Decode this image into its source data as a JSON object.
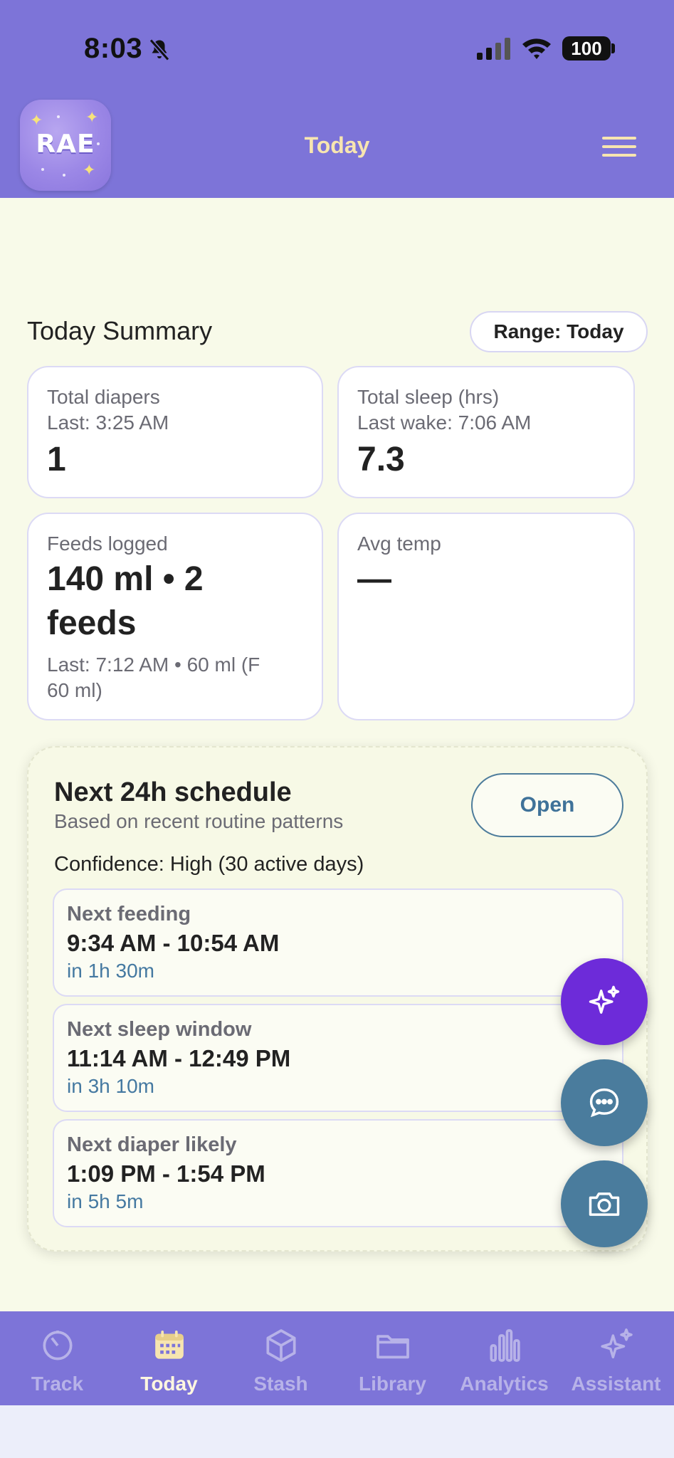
{
  "status_bar": {
    "time": "8:03",
    "battery": "100"
  },
  "header": {
    "logo_text": "RAE",
    "title": "Today"
  },
  "summary": {
    "title": "Today Summary",
    "range_label": "Range: Today",
    "cards": {
      "diapers": {
        "label": "Total diapers",
        "sub": "Last: 3:25 AM",
        "value": "1"
      },
      "sleep": {
        "label": "Total sleep (hrs)",
        "sub": "Last wake: 7:06 AM",
        "value": "7.3"
      },
      "feeds": {
        "label": "Feeds logged",
        "value_line1": "140 ml • 2",
        "value_line2": "feeds",
        "sub_line1": "Last: 7:12 AM • 60 ml (F",
        "sub_line2": "60 ml)"
      },
      "temp": {
        "label": "Avg temp",
        "value": "—"
      }
    }
  },
  "schedule": {
    "title": "Next 24h schedule",
    "subtitle": "Based on recent routine patterns",
    "open_label": "Open",
    "confidence": "Confidence: High (30 active days)",
    "items": [
      {
        "label": "Next feeding",
        "time": "9:34 AM - 10:54 AM",
        "in": "in 1h 30m"
      },
      {
        "label": "Next sleep window",
        "time": "11:14 AM - 12:49 PM",
        "in": "in 3h 10m"
      },
      {
        "label": "Next diaper likely",
        "time": "1:09 PM - 1:54 PM",
        "in": "in 5h 5m"
      }
    ]
  },
  "fabs": [
    {
      "icon": "sparkles-icon",
      "color": "#6d2bd9"
    },
    {
      "icon": "chat-icon",
      "color": "#4a7c9d"
    },
    {
      "icon": "camera-icon",
      "color": "#4a7c9d"
    }
  ],
  "tabs": [
    {
      "label": "Track",
      "icon": "timer-icon"
    },
    {
      "label": "Today",
      "icon": "calendar-icon",
      "active": true
    },
    {
      "label": "Stash",
      "icon": "box-icon"
    },
    {
      "label": "Library",
      "icon": "folder-icon"
    },
    {
      "label": "Analytics",
      "icon": "bar-chart-icon"
    },
    {
      "label": "Assistant",
      "icon": "sparkles-icon"
    }
  ],
  "colors": {
    "header": "#7d74d8",
    "background": "#f8fae9",
    "accent_title": "#f7e5b0",
    "link_blue": "#4579a1"
  }
}
